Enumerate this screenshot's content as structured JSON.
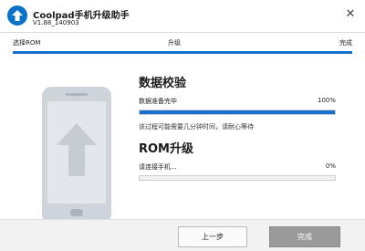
{
  "window": {
    "title": "Coolpad手机升级助手",
    "version": "V1.88_140903",
    "close_label": "✕"
  },
  "steps": {
    "items": [
      "选择ROM",
      "升级",
      "完成"
    ]
  },
  "phone": {
    "icon": "phone-upgrade-arrow-icon"
  },
  "verify": {
    "title": "数据校验",
    "status": "数据准备完毕",
    "percent_label": "100%",
    "progress": 1.0,
    "note": "该过程可能需要几分钟时间，请耐心等待"
  },
  "rom_upgrade": {
    "title": "ROM升级",
    "status": "请连接手机...",
    "percent_label": "0%",
    "progress": 0.0
  },
  "footer": {
    "prev_label": "上一步",
    "done_label": "完成"
  },
  "colors": {
    "accent": "#1670d0",
    "brand": "#0a72c9",
    "disabled_button": "#9a9a9a"
  }
}
